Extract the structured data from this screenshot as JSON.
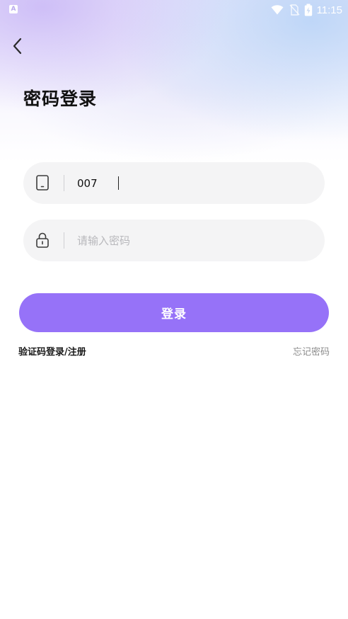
{
  "status_bar": {
    "app_icon_letter": "A",
    "time": "11:15",
    "icons": [
      "wifi-icon",
      "no-sim-icon",
      "battery-charging-icon"
    ]
  },
  "header": {
    "back_icon": "chevron-left-icon",
    "title": "密码登录"
  },
  "form": {
    "phone": {
      "icon": "phone-icon",
      "value": "007",
      "placeholder": ""
    },
    "password": {
      "icon": "lock-icon",
      "value": "",
      "placeholder": "请输入密码"
    },
    "login_label": "登录"
  },
  "links": {
    "sms_login": "验证码登录/注册",
    "forgot_password": "忘记密码"
  },
  "colors": {
    "accent": "#9672f8",
    "input_bg": "#f4f4f5",
    "title": "#111111",
    "muted": "#8c8c8c"
  }
}
